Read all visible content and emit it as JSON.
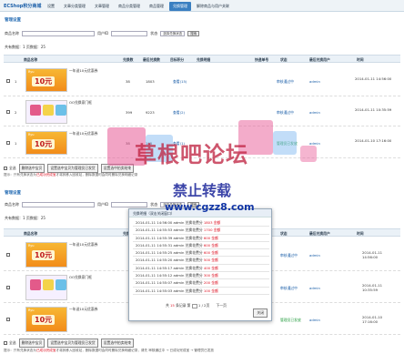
{
  "app": {
    "logo": "ECShop积分商城"
  },
  "nav": [
    "设置",
    "文章分类管理",
    "文章管理",
    "商品分类管理",
    "商品管理",
    "兑换管理",
    "解除商品与用户关联"
  ],
  "section1": {
    "title": "管理设置",
    "filter": {
      "name_label": "商品名称",
      "user_label": "用户ID",
      "status_label": "状态",
      "status_select": "选择兑换状态",
      "search_btn": "搜索"
    },
    "count": "共有数据：1 页数据：25",
    "headers": [
      "商品名称",
      "兑换数",
      "最后兑换数",
      "目标积分",
      "兑换明细",
      "快递单号",
      "状态",
      "最后兑换用户",
      "时间"
    ],
    "rows": [
      {
        "caption": "一年送10元优惠券",
        "count": "38",
        "last": "1803",
        "link": "查看(15)",
        "status": "审核通过中",
        "user": "admin",
        "time": "2014-01-11 14:56:00",
        "kind": "coupon"
      },
      {
        "caption": "OO兑换家门框",
        "count": "399",
        "last": "9223",
        "link": "查看(2)",
        "status": "审核通过中",
        "user": "admin",
        "time": "2014-01-11 10:35:59",
        "kind": "tshirt"
      },
      {
        "caption": "一年送10元优惠券",
        "count": "38",
        "last": "145",
        "link": "查看(1)",
        "status": "管理员已发放",
        "user": "admin",
        "time": "2014-01-10 17:16:00",
        "kind": "coupon"
      }
    ],
    "actions": {
      "select_all": "全选",
      "b1": "删除选中宝贝",
      "b2": "设置选中宝贝为管理员已发货",
      "b3": "设置选中拍卖结束"
    },
    "hint": "提示：只有兑换状态为",
    "hint_red": "已成功完成宝",
    "hint_rest": "才将其移入回收站，删除数据时会同时删除兑换明细记录"
  },
  "section2": {
    "title": "管理设置",
    "filter": {
      "name_label": "商品名称",
      "user_label": "用户ID",
      "status_label": "状态",
      "status_select": "选择兑换状态",
      "search_btn": "搜索"
    },
    "count": "共有数据：1 页数据：25",
    "headers": [
      "商品名称",
      "兑换数",
      "最后兑换数",
      "目标积分",
      "兑换明细",
      "快递单号",
      "状态",
      "最后兑换用户",
      "时间"
    ],
    "rows": [
      {
        "caption": "一年送10元优惠券",
        "status": "审核通过中",
        "user": "admin",
        "time": "2014-01-11 14:56:00",
        "kind": "coupon"
      },
      {
        "caption": "OO兑换家门框",
        "status": "审核通过中",
        "user": "admin",
        "time": "2014-01-11 10:35:59",
        "kind": "tshirt"
      },
      {
        "caption": "一年送10元优惠券",
        "status": "管理员已发放",
        "user": "admin",
        "time": "2014-01-10 17:16:00",
        "kind": "coupon"
      }
    ],
    "actions": {
      "select_all": "全选",
      "b1": "删除选中宝贝",
      "b2": "设置选中宝贝为管理员已发货",
      "b3": "设置选中拍卖结束"
    },
    "hint": "提示：只有兑换状态为",
    "hint_red": "已成功完成宝",
    "hint_rest": "才将其移入回收站，删除数据时会同时删除兑换明细记录，请先  审核通过中 → 已成功完成宝 → 管理员已发放"
  },
  "popup": {
    "title": "兑换明细（双击关闭窗口）",
    "entries": [
      {
        "text": "2014-01-11 14:56:00 admin 兑换花费分 ",
        "amount": "1803 金额"
      },
      {
        "text": "2014-01-11 14:55:53 admin 兑换花费分 ",
        "amount": "1700 金额"
      },
      {
        "text": "2014-01-11 14:55:39 admin 兑换花费分 ",
        "amount": "600 金额"
      },
      {
        "text": "2014-01-11 14:55:31 admin 兑换花费分 ",
        "amount": "600 金额"
      },
      {
        "text": "2014-01-11 14:55:25 admin 兑换花费分 ",
        "amount": "600 金额"
      },
      {
        "text": "2014-01-11 14:55:20 admin 兑换花费分 ",
        "amount": "500 金额"
      },
      {
        "text": "2014-01-11 14:55:17 admin 兑换花费分 ",
        "amount": "400 金额"
      },
      {
        "text": "2014-01-11 14:55:12 admin 兑换花费分 ",
        "amount": "300 金额"
      },
      {
        "text": "2014-01-11 14:55:07 admin 兑换花费分 ",
        "amount": "200 金额"
      },
      {
        "text": "2014-01-11 14:55:03 admin 兑换花费分 ",
        "amount": "100 金额"
      }
    ],
    "pager_total_prefix": "共",
    "pager_total": "15",
    "pager_total_suffix": "条记录 第",
    "pager_page": "1",
    "pager_of": "/ 2页",
    "pager_next": "下一页",
    "close": "关闭"
  },
  "watermark": {
    "line1": "草根吧论坛",
    "line2": "禁止转载",
    "line3": "www.cgzz8.com"
  },
  "coupon_text": "10元",
  "coupon_tag": "Ryu"
}
